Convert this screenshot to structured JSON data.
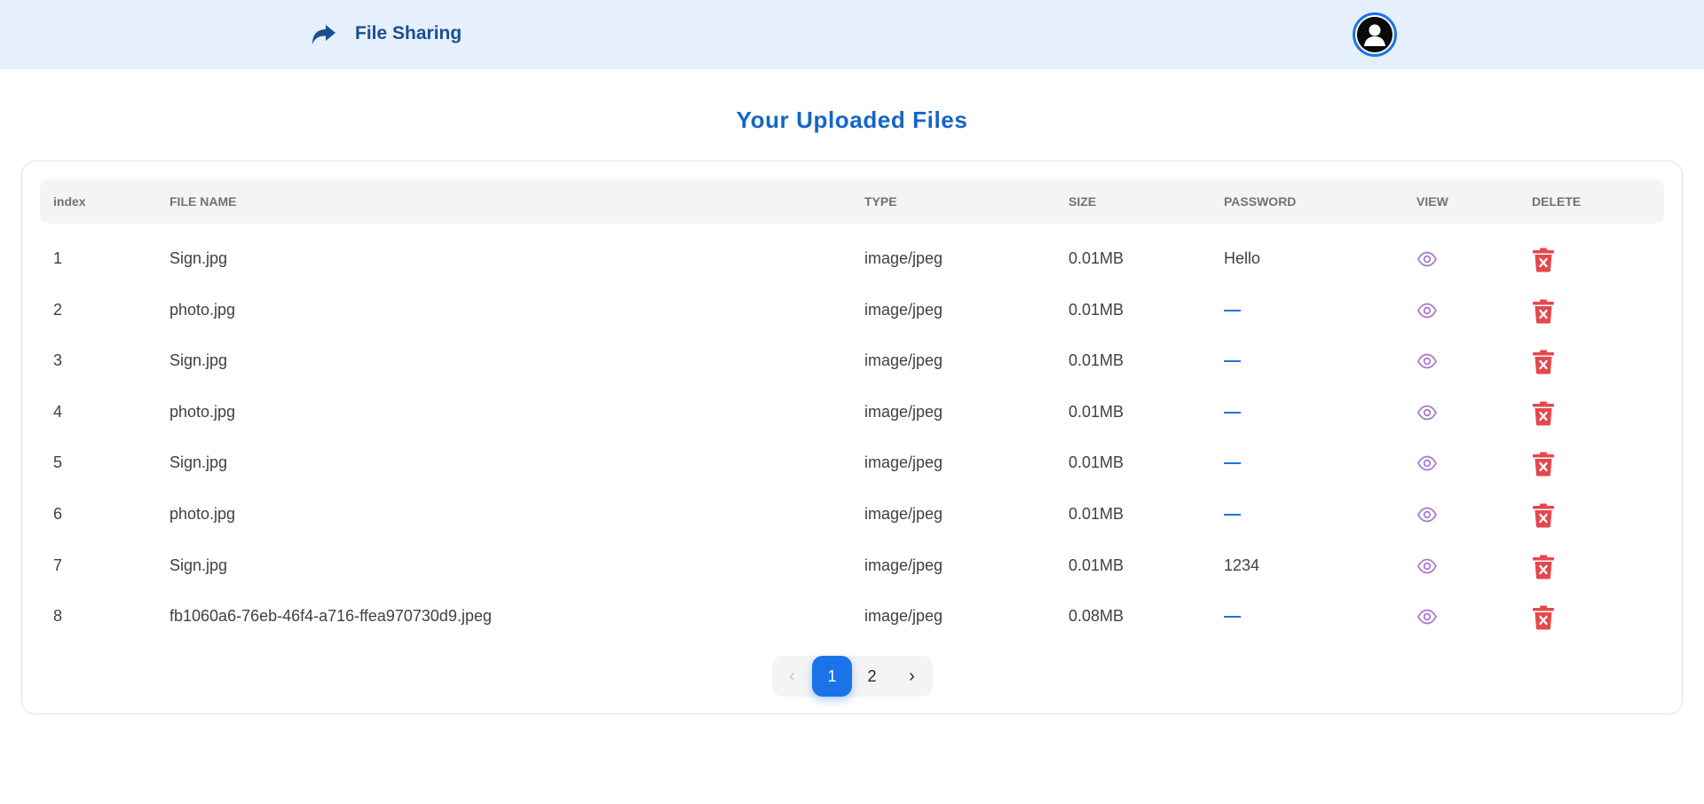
{
  "brand": {
    "name": "File Sharing",
    "icon": "share-arrow-icon"
  },
  "header": {
    "avatar_icon": "user-avatar-icon"
  },
  "title": "Your Uploaded Files",
  "table": {
    "columns": [
      "index",
      "FILE NAME",
      "TYPE",
      "SIZE",
      "PASSWORD",
      "VIEW",
      "DELETE"
    ],
    "rows": [
      {
        "index": "1",
        "name": "Sign.jpg",
        "type": "image/jpeg",
        "size": "0.01MB",
        "password": "Hello"
      },
      {
        "index": "2",
        "name": "photo.jpg",
        "type": "image/jpeg",
        "size": "0.01MB",
        "password": null
      },
      {
        "index": "3",
        "name": "Sign.jpg",
        "type": "image/jpeg",
        "size": "0.01MB",
        "password": null
      },
      {
        "index": "4",
        "name": "photo.jpg",
        "type": "image/jpeg",
        "size": "0.01MB",
        "password": null
      },
      {
        "index": "5",
        "name": "Sign.jpg",
        "type": "image/jpeg",
        "size": "0.01MB",
        "password": null
      },
      {
        "index": "6",
        "name": "photo.jpg",
        "type": "image/jpeg",
        "size": "0.01MB",
        "password": null
      },
      {
        "index": "7",
        "name": "Sign.jpg",
        "type": "image/jpeg",
        "size": "0.01MB",
        "password": "1234"
      },
      {
        "index": "8",
        "name": "fb1060a6-76eb-46f4-a716-ffea970730d9.jpeg",
        "type": "image/jpeg",
        "size": "0.08MB",
        "password": null
      }
    ]
  },
  "pagination": {
    "prev": "‹",
    "pages": [
      "1",
      "2"
    ],
    "current": "1",
    "next": "›"
  },
  "icons": {
    "view": "eye-icon",
    "delete": "trash-icon",
    "prev": "chevron-left-icon",
    "next": "chevron-right-icon"
  },
  "colors": {
    "accent": "#1a73e8",
    "title": "#1466c6",
    "brand": "#1b4f8f",
    "header_bg": "#e6f0fc",
    "view_icon": "#a87cd0",
    "delete_icon": "#e5484d"
  }
}
